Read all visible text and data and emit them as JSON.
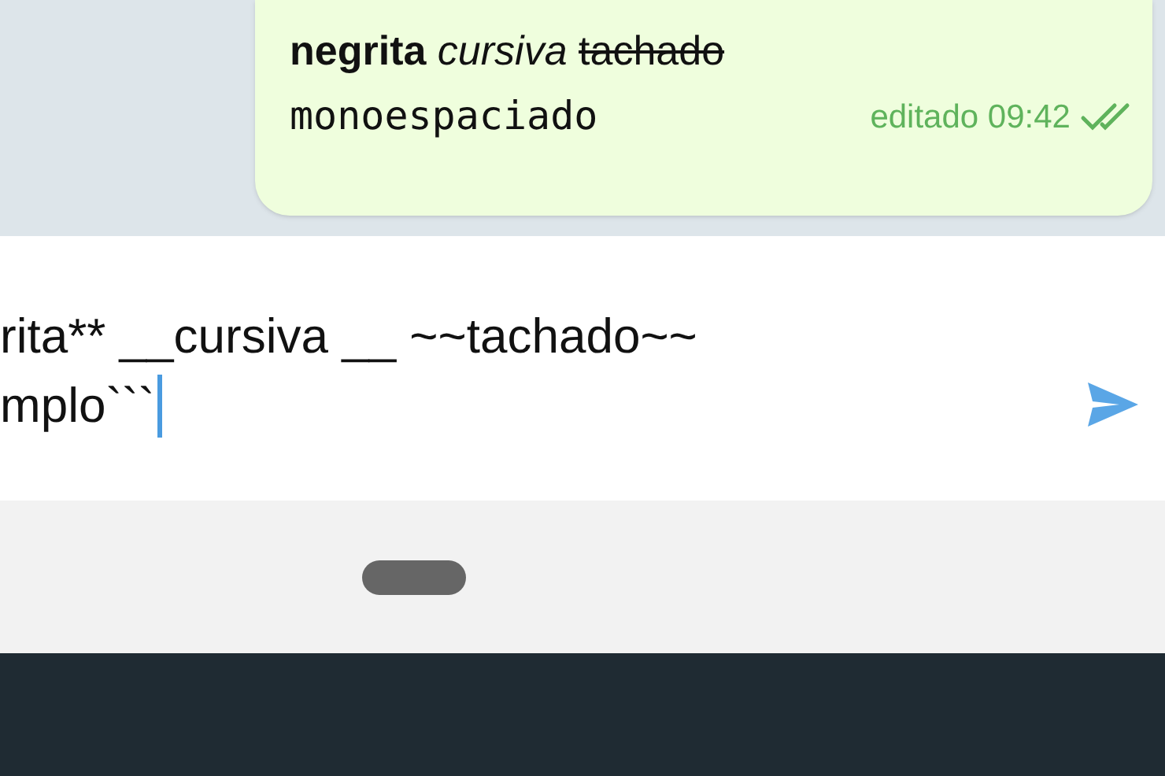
{
  "message": {
    "segments": [
      {
        "kind": "bold",
        "text": "negrita"
      },
      {
        "kind": "italic",
        "text": "cursiva"
      },
      {
        "kind": "strike",
        "text": "tachado"
      }
    ],
    "mono_line": "monoespaciado",
    "meta": "editado 09:42",
    "read": true
  },
  "composer": {
    "lines": [
      "rita** __cursiva __ ~~tachado~~",
      "mplo```"
    ]
  }
}
